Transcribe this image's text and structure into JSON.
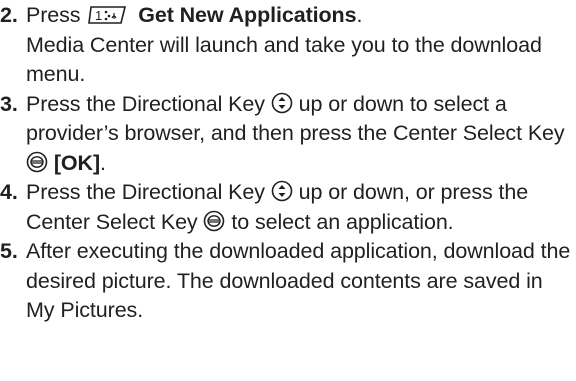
{
  "steps": [
    {
      "num": "2.",
      "pre": "Press",
      "icon": "keypad-1-key-icon",
      "bold": "Get New Applications",
      "tail": ".",
      "continuation": "Media Center will launch and take you to the download menu."
    },
    {
      "num": "3.",
      "pre": "Press the Directional Key",
      "icon": "directional-key-icon",
      "mid": "up or down to select a provider’s browser, and then press the Center Select Key",
      "icon2": "center-select-key-icon",
      "bold": "[OK]",
      "tail": "."
    },
    {
      "num": "4.",
      "pre": "Press the Directional Key",
      "icon": "directional-key-icon",
      "mid": "up or down, or press the Center Select Key",
      "icon2": "center-select-key-icon",
      "tail": "to select an application."
    },
    {
      "num": "5.",
      "text": "After executing the downloaded application, download the desired picture. The downloaded contents are saved in My Pictures."
    }
  ]
}
